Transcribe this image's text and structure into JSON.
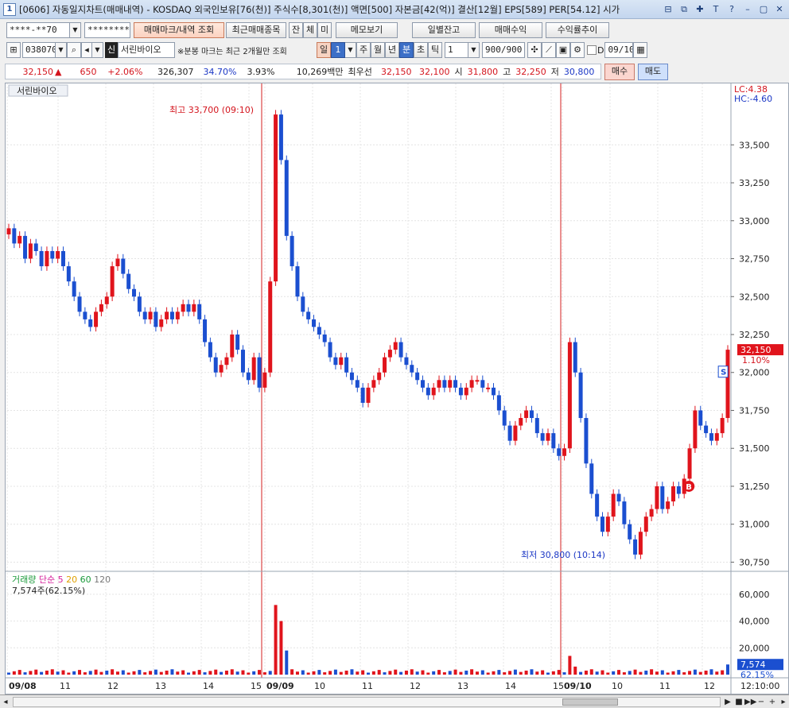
{
  "window": {
    "number": "1",
    "title": "[0606] 자동일지차트(매매내역) - KOSDAQ 외국인보유[76(천)] 주식수[8,301(천)] 액면[500] 자본금[42(억)] 결산[12월] EPS[589] PER[54.12] 시가",
    "controls": [
      "⊟",
      "⧉",
      "✚",
      "T",
      "?",
      "–",
      "▢",
      "✕"
    ]
  },
  "toolbar1": {
    "account": "****-**70",
    "password": "********",
    "btn_mark": "매매마크/내역 조회",
    "btn_recent": "최근매매종목",
    "btn_jan": "잔",
    "btn_che": "체",
    "btn_mi": "미",
    "btn_memo": "메모보기",
    "btn_daily": "일별잔고",
    "btn_profit": "매매수익",
    "btn_trend": "수익률추이"
  },
  "toolbar2": {
    "code": "038070",
    "badge": "신",
    "name": "서린바이오",
    "notice": "※분봉 마크는 최근 2개월만 조회",
    "period_il": "일",
    "period_val": "1",
    "p_ju": "주",
    "p_wol": "월",
    "p_nyeon": "년",
    "p_bun": "분",
    "p_cho": "초",
    "p_tik": "틱",
    "interval": "1",
    "count": "900/900",
    "date_chk": "D",
    "date": "09/10"
  },
  "quote": {
    "price": "32,150",
    "arrow": "▲",
    "change": "650",
    "rate": "+2.06%",
    "volume": "326,307",
    "vol_ratio": "34.70%",
    "turnover": "3.93%",
    "amount": "10,269백만",
    "best_label": "최우선",
    "ask": "32,150",
    "bid": "32,100",
    "open_label": "시",
    "open": "31,800",
    "high_label": "고",
    "high": "32,250",
    "low_label": "저",
    "low": "30,800",
    "buy_btn": "매수",
    "sell_btn": "매도"
  },
  "chart_data": {
    "type": "candlestick",
    "title": "서린바이오",
    "lc_label": "LC:4.38",
    "hc_label": "HC:-4.60",
    "price_ylim": [
      30700,
      33800
    ],
    "price_ticks": [
      "33,500",
      "33,250",
      "33,000",
      "32,750",
      "32,500",
      "32,250",
      "32,000",
      "31,750",
      "31,500",
      "31,250",
      "31,000",
      "30,750"
    ],
    "current_price_tag": "32,150",
    "current_rate_tag": "1.10%",
    "high_annotation": "최고 33,700 (09:10)",
    "low_annotation": "최저 30,800 (10:14)",
    "buy_marker": "B",
    "sell_marker": "S",
    "x_labels": [
      "09/08",
      "11",
      "12",
      "13",
      "14",
      "15",
      "09/09",
      "10",
      "11",
      "12",
      "13",
      "14",
      "15",
      "09/10",
      "10",
      "11",
      "12",
      "12:10:00"
    ],
    "price_path": [
      32950,
      32850,
      32900,
      32750,
      32850,
      32800,
      32700,
      32800,
      32750,
      32800,
      32700,
      32600,
      32500,
      32400,
      32350,
      32300,
      32400,
      32450,
      32500,
      32700,
      32750,
      32650,
      32550,
      32500,
      32400,
      32350,
      32400,
      32300,
      32350,
      32400,
      32350,
      32400,
      32450,
      32400,
      32450,
      32350,
      32200,
      32100,
      32000,
      32050,
      32100,
      32250,
      32150,
      32000,
      31950,
      32100,
      31900,
      32000,
      32600,
      33700,
      33400,
      32900,
      32700,
      32500,
      32400,
      32350,
      32300,
      32250,
      32200,
      32100,
      32050,
      32100,
      32000,
      31950,
      31900,
      31800,
      31900,
      31950,
      32000,
      32100,
      32150,
      32200,
      32100,
      32050,
      32000,
      31950,
      31900,
      31850,
      31900,
      31950,
      31900,
      31950,
      31900,
      31850,
      31900,
      31950,
      31950,
      31900,
      31900,
      31850,
      31750,
      31650,
      31550,
      31650,
      31700,
      31750,
      31700,
      31600,
      31550,
      31600,
      31500,
      31450,
      31500,
      32200,
      32000,
      31700,
      31400,
      31200,
      31050,
      30950,
      31050,
      31200,
      31150,
      31000,
      30900,
      30800,
      30950,
      31050,
      31100,
      31250,
      31100,
      31150,
      31250,
      31200,
      31300,
      31500,
      31750,
      31650,
      31600,
      31550,
      31600,
      31700,
      32150
    ],
    "volume_legend": {
      "name": "거래량",
      "ma_label": "단순",
      "ma5": "5",
      "ma20": "20",
      "ma60": "60",
      "ma120": "120",
      "current": "7,574주(62.15%)"
    },
    "volume_ylim": [
      0,
      70000
    ],
    "volume_ticks": [
      "60,000",
      "40,000",
      "20,000"
    ],
    "volume_tag": "7,574",
    "volume_rate_tag": "62.15%",
    "colors": {
      "up": "#e0141c",
      "down": "#1b4fd0",
      "ma5": "#d61f9a",
      "ma20": "#e0a000",
      "ma60": "#1a9a3a",
      "ma120": "#777777",
      "vline": "#d42020"
    }
  },
  "statusbar": {
    "time": "12:10:00"
  }
}
